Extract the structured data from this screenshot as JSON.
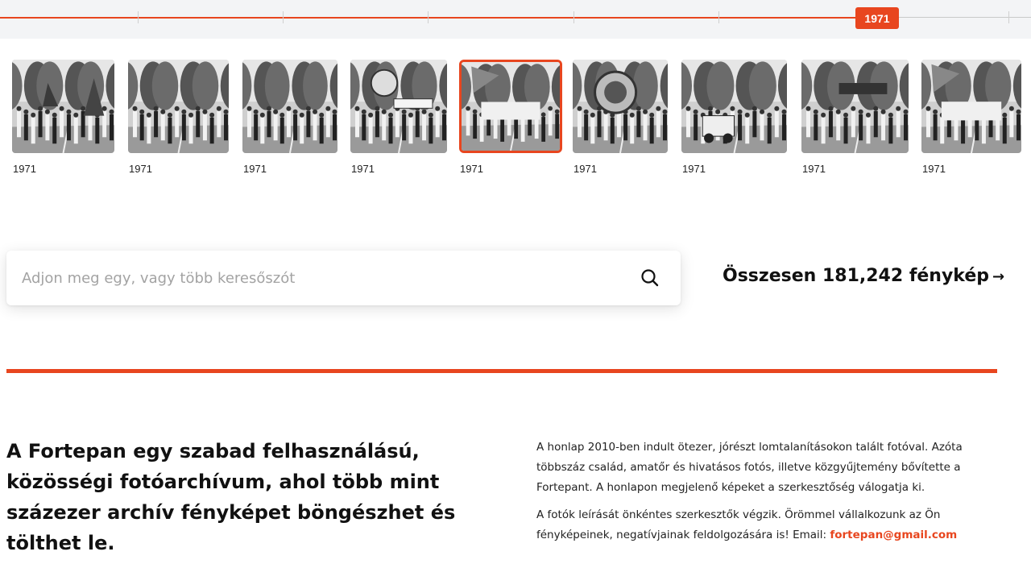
{
  "timeline": {
    "selected_year": "1971"
  },
  "thumbnails": [
    {
      "year": "1971",
      "scene": "flags"
    },
    {
      "year": "1971",
      "scene": "crowd"
    },
    {
      "year": "1971",
      "scene": "crowd-closeup"
    },
    {
      "year": "1971",
      "scene": "banner-sign"
    },
    {
      "year": "1971",
      "scene": "letters",
      "selected": true
    },
    {
      "year": "1971",
      "scene": "emblem"
    },
    {
      "year": "1971",
      "scene": "vehicle"
    },
    {
      "year": "1971",
      "scene": "haziipar-sign"
    },
    {
      "year": "1971",
      "scene": "afesz-letters"
    }
  ],
  "search": {
    "placeholder": "Adjon meg egy, vagy több keresőszót",
    "icon": "search-icon"
  },
  "stats": {
    "total_label": "Összesen 181,242 fénykép",
    "arrow": "→"
  },
  "headline": "A Fortepan egy szabad felhasználású, közösségi fotóarchívum, ahol több mint százezer archív fényképet böngészhet és tölthet le.",
  "about": {
    "paragraph1": "A honlap 2010-ben indult ötezer, jórészt lomtalanításokon talált fotóval. Azóta többszáz család, amatőr és hivatásos fotós, illetve közgyűjtemény bővítette a Fortepant. A honlapon megjelenő képeket a szerkesztőség válogatja ki.",
    "paragraph2": "A fotók leírását önkéntes szerkesztők végzik. Örömmel vállalkozunk az Ön fényképeinek, negatívjainak feldolgozására is! Email:",
    "email": "fortepan@gmail.com"
  },
  "colors": {
    "accent": "#e8461f",
    "timeline_bg": "#f3f4f6"
  }
}
